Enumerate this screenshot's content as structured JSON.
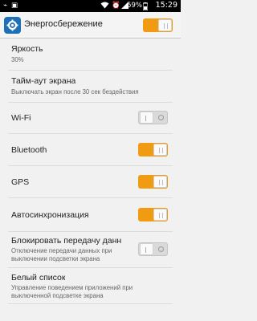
{
  "status_bar": {
    "battery_percent": "59%",
    "time": "15:29"
  },
  "action_bar": {
    "icon": "gear-icon",
    "title": "Энергосбережение",
    "toggle_on": true
  },
  "settings": [
    {
      "title": "Яркость",
      "subtitle": "30%"
    },
    {
      "title": "Тайм-аут экрана",
      "subtitle": "Выключать экран после 30 сек бездействия"
    },
    {
      "title": "Wi-Fi",
      "toggle_on": false
    },
    {
      "title": "Bluetooth",
      "toggle_on": true
    },
    {
      "title": "GPS",
      "toggle_on": true
    },
    {
      "title": "Автосинхронизация",
      "toggle_on": true
    },
    {
      "title": "Блокировать передачу данн",
      "subtitle": "Отключение передачи данных при выключении подсветки экрана",
      "toggle_on": false
    },
    {
      "title": "Белый список",
      "subtitle": "Управление поведением приложений при выключенной подсветке экрана"
    }
  ],
  "colors": {
    "accent": "#f19b12",
    "background": "#f1f1f1"
  }
}
